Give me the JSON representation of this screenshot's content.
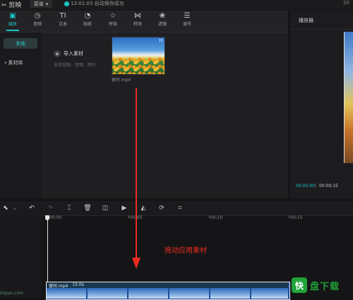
{
  "topbar": {
    "app_title": "剪映",
    "menu_label": "菜单",
    "save_status": "13:01:03 自动保存成功",
    "top_right": "20"
  },
  "toolbar": {
    "items": [
      {
        "label": "媒体",
        "icon": "media-icon",
        "active": true
      },
      {
        "label": "音频",
        "icon": "audio-icon"
      },
      {
        "label": "文本",
        "icon": "text-icon",
        "glyph": "TI"
      },
      {
        "label": "贴纸",
        "icon": "sticker-icon"
      },
      {
        "label": "特效",
        "icon": "effects-icon"
      },
      {
        "label": "转场",
        "icon": "transition-icon"
      },
      {
        "label": "滤镜",
        "icon": "filter-icon"
      },
      {
        "label": "调节",
        "icon": "adjust-icon"
      }
    ]
  },
  "sidebar": {
    "local_label": "本地",
    "library_label": "素材库"
  },
  "media": {
    "import_label": "导入素材",
    "import_hint": "支持视频、音频、图片",
    "clip_name": "留时.mp4",
    "clip_duration": "15"
  },
  "player": {
    "title": "播放器",
    "current_time": "00:00:00",
    "separator": "|",
    "total_time": "00:00:15"
  },
  "timeline": {
    "ticks": [
      "00:00",
      "00:05",
      "00:10",
      "00:15"
    ],
    "clip_label": "留时.mp4",
    "clip_duration": "15.0s"
  },
  "annotation": "拖动应用素材",
  "watermark": "kkpan.com",
  "brand": {
    "icon_glyph": "快",
    "text": "盘下载"
  },
  "colors": {
    "accent": "#18c7c7",
    "annotation_red": "#ee2b1e",
    "brand_green": "#1f9e35"
  }
}
